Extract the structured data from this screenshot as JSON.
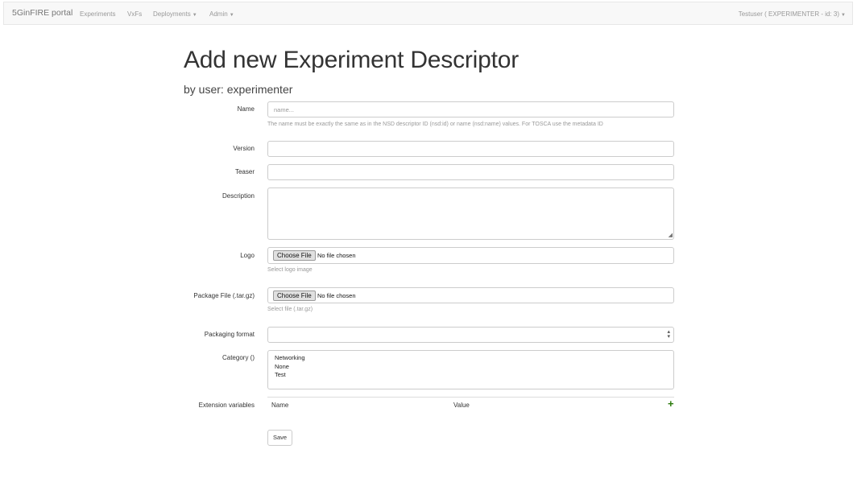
{
  "nav": {
    "brand": "5GinFIRE portal",
    "items": [
      {
        "label": "Experiments"
      },
      {
        "label": "VxFs"
      },
      {
        "label": "Deployments",
        "dropdown": true
      },
      {
        "label": "Admin",
        "dropdown": true
      }
    ],
    "user_label": "Testuser ( EXPERIMENTER - id: 3)"
  },
  "page": {
    "title": "Add new Experiment Descriptor",
    "subtitle": "by user: experimenter"
  },
  "form": {
    "name": {
      "label": "Name",
      "placeholder": "name...",
      "help": "The name must be exactly the same as in the NSD descriptor ID (nsd:id) or name (nsd:name) values. For TOSCA use the metadata ID"
    },
    "version": {
      "label": "Version",
      "value": ""
    },
    "teaser": {
      "label": "Teaser",
      "value": ""
    },
    "description": {
      "label": "Description",
      "value": ""
    },
    "logo": {
      "label": "Logo",
      "button": "Choose File",
      "status": "No file chosen",
      "help": "Select logo image"
    },
    "package": {
      "label": "Package File (.tar.gz)",
      "button": "Choose File",
      "status": "No file chosen",
      "help": "Select file (.tar.gz)"
    },
    "packaging_format": {
      "label": "Packaging format",
      "value": ""
    },
    "category": {
      "label": "Category ()",
      "options": [
        "Networking",
        "None",
        "Test"
      ]
    },
    "extension": {
      "label": "Extension variables",
      "col_name": "Name",
      "col_value": "Value",
      "add_icon": "plus-icon"
    },
    "save_label": "Save"
  },
  "colors": {
    "add_icon": "#2b7a0b",
    "nav_bg": "#f8f8f8"
  }
}
